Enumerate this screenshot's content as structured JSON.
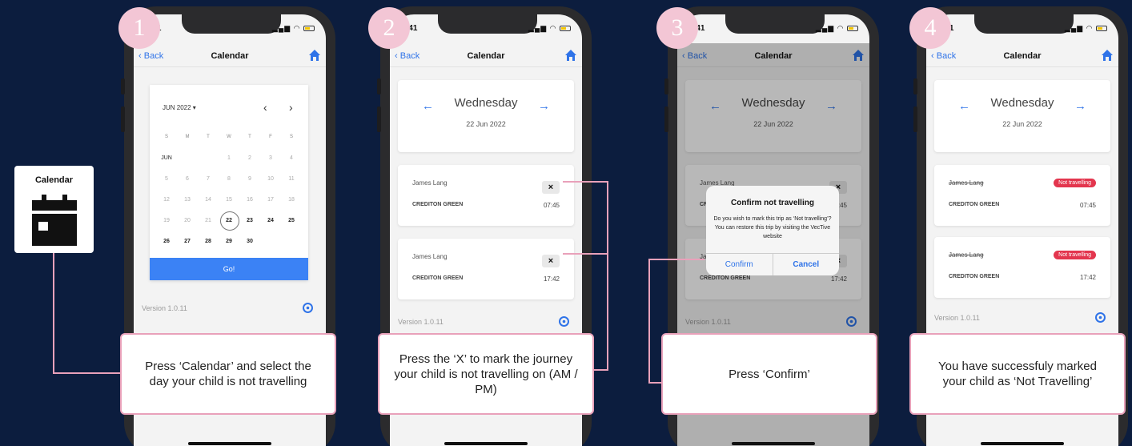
{
  "side": {
    "label": "Calendar"
  },
  "status": {
    "time": ":41"
  },
  "nav": {
    "back": "Back",
    "title": "Calendar"
  },
  "version": "Version 1.0.11",
  "steps": [
    {
      "num": "1",
      "caption": "Press ‘Calendar’ and select the day your child is not travelling"
    },
    {
      "num": "2",
      "caption": "Press the ‘X’ to mark the journey your child is not travelling on (AM / PM)"
    },
    {
      "num": "3",
      "caption": "Press ‘Confirm’"
    },
    {
      "num": "4",
      "caption": "You have successfuly marked your child as ‘Not Travelling’"
    }
  ],
  "calendar": {
    "month_label": "JUN 2022",
    "weekdays": [
      "S",
      "M",
      "T",
      "W",
      "T",
      "F",
      "S"
    ],
    "row_month_tag": "JUN",
    "weeks": [
      [
        "JUN",
        "",
        "",
        "1",
        "2",
        "3",
        "4"
      ],
      [
        "5",
        "6",
        "7",
        "8",
        "9",
        "10",
        "11"
      ],
      [
        "12",
        "13",
        "14",
        "15",
        "16",
        "17",
        "18"
      ],
      [
        "19",
        "20",
        "21",
        "22",
        "23",
        "24",
        "25"
      ],
      [
        "26",
        "27",
        "28",
        "29",
        "30",
        "",
        ""
      ]
    ],
    "selected": "22",
    "go_label": "Go!"
  },
  "day": {
    "name": "Wednesday",
    "date": "22 Jun 2022"
  },
  "trips": [
    {
      "name": "James Lang",
      "place": "CREDITON GREEN",
      "time": "07:45"
    },
    {
      "name": "James Lang",
      "place": "CREDITON GREEN",
      "time": "17:42"
    }
  ],
  "x_label": "×",
  "badge_label": "Not travelling",
  "dialog": {
    "title": "Confirm not travelling",
    "message": "Do you wish to mark this trip as ‘Not travelling’? You can restore this trip by visiting the VecTive website",
    "confirm": "Confirm",
    "cancel": "Cancel"
  },
  "colors": {
    "background": "#0c1d3e",
    "accent": "#2f73e8",
    "pink": "#e9a1ba",
    "badge": "#e3364e"
  }
}
